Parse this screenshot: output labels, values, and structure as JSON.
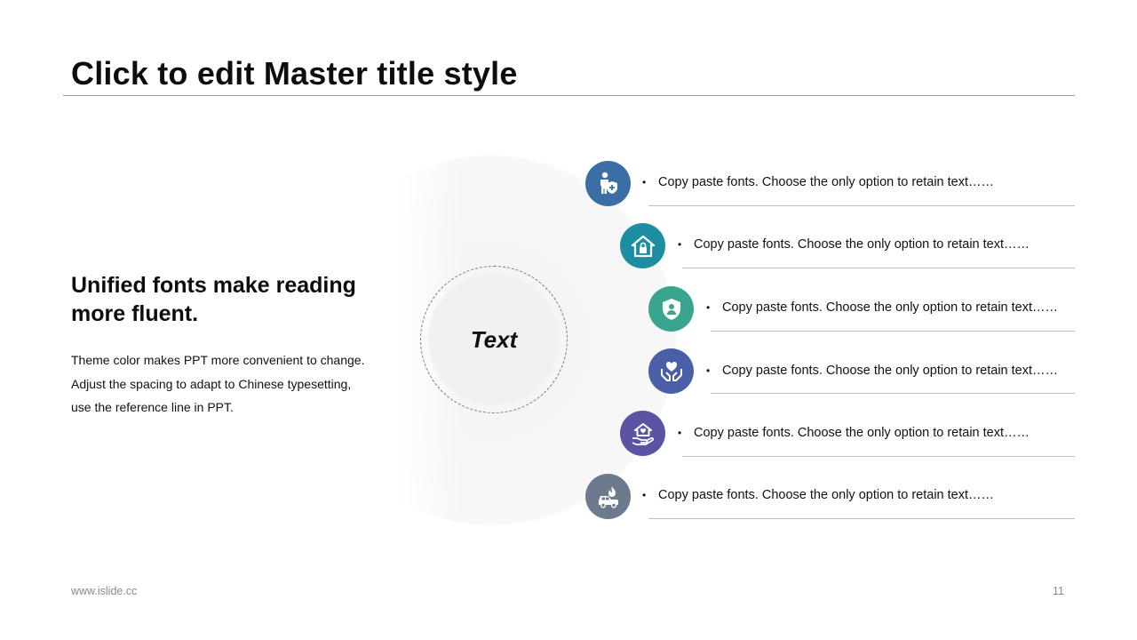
{
  "slide": {
    "title": "Click to edit Master title style",
    "subtitle": "Unified fonts make reading more fluent.",
    "body_lines": [
      "Theme color makes PPT more convenient to change.",
      "Adjust the spacing to adapt to Chinese typesetting,",
      "use the reference line in PPT."
    ],
    "center_label": "Text"
  },
  "items": [
    {
      "text": "Copy paste fonts. Choose the only option to retain text……",
      "icon": "person-shield-icon",
      "color": "#3a6ea5"
    },
    {
      "text": "Copy paste fonts. Choose the only option to retain text……",
      "icon": "home-lock-icon",
      "color": "#1d8ea1"
    },
    {
      "text": "Copy paste fonts. Choose the only option to retain text……",
      "icon": "shield-person-icon",
      "color": "#3aa58e"
    },
    {
      "text": "Copy paste fonts. Choose the only option to retain text……",
      "icon": "hands-heart-icon",
      "color": "#4b5fa8"
    },
    {
      "text": "Copy paste fonts. Choose the only option to retain text……",
      "icon": "hand-house-icon",
      "color": "#5b54a3"
    },
    {
      "text": "Copy paste fonts. Choose the only option to retain text……",
      "icon": "car-fire-icon",
      "color": "#6b7a8c"
    }
  ],
  "footer": {
    "website": "www.islide.cc",
    "page_number": "11"
  }
}
